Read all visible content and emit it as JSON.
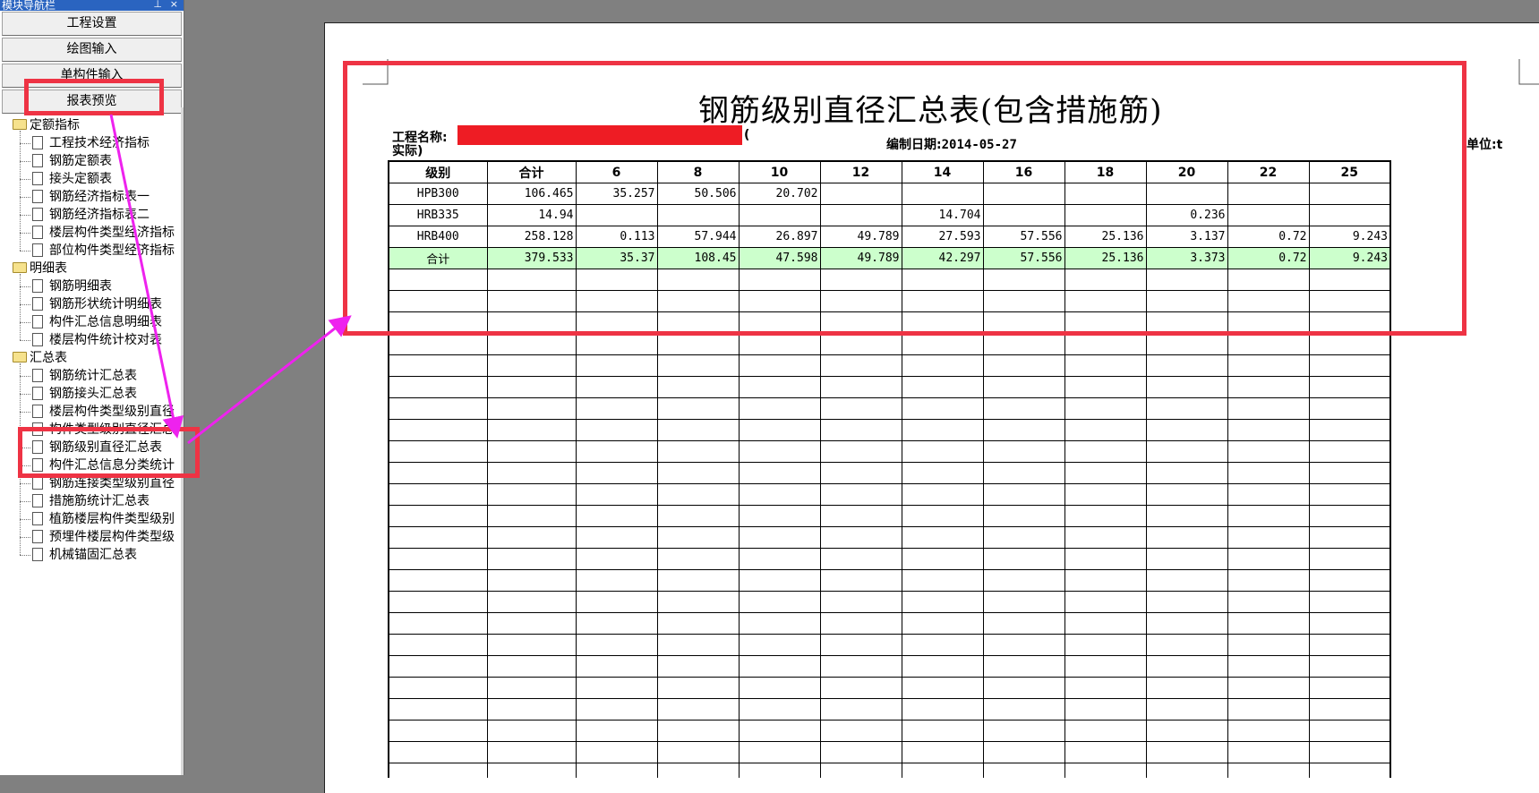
{
  "nav": {
    "title": "模块导航栏",
    "pin_glyph": "⊥",
    "close_glyph": "×",
    "buttons": [
      "工程设置",
      "绘图输入",
      "单构件输入",
      "报表预览"
    ],
    "groups": [
      {
        "label": "定额指标",
        "items": [
          "工程技术经济指标",
          "钢筋定额表",
          "接头定额表",
          "钢筋经济指标表一",
          "钢筋经济指标表二",
          "楼层构件类型经济指标",
          "部位构件类型经济指标"
        ]
      },
      {
        "label": "明细表",
        "items": [
          "钢筋明细表",
          "钢筋形状统计明细表",
          "构件汇总信息明细表",
          "楼层构件统计校对表"
        ]
      },
      {
        "label": "汇总表",
        "items": [
          "钢筋统计汇总表",
          "钢筋接头汇总表",
          "楼层构件类型级别直径",
          "构件类型级别直径汇总",
          "钢筋级别直径汇总表",
          "构件汇总信息分类统计",
          "钢筋连接类型级别直径",
          "措施筋统计汇总表",
          "植筋楼层构件类型级别",
          "预埋件楼层构件类型级",
          "机械锚固汇总表"
        ]
      }
    ]
  },
  "report": {
    "title": "钢筋级别直径汇总表(包含措施筋)",
    "project_label": "工程名称:",
    "project_suffix": "(",
    "project_line2": "实际)",
    "date_label": "编制日期:",
    "date_value": "2014-05-27",
    "unit_label": "单位:",
    "unit_value": "t",
    "columns": [
      "级别",
      "合计",
      "6",
      "8",
      "10",
      "12",
      "14",
      "16",
      "18",
      "20",
      "22",
      "25"
    ],
    "rows": [
      {
        "grade": "HPB300",
        "cells": [
          "106.465",
          "35.257",
          "50.506",
          "20.702",
          "",
          "",
          "",
          "",
          "",
          "",
          ""
        ]
      },
      {
        "grade": "HRB335",
        "cells": [
          "14.94",
          "",
          "",
          "",
          "",
          "14.704",
          "",
          "",
          "0.236",
          "",
          ""
        ]
      },
      {
        "grade": "HRB400",
        "cells": [
          "258.128",
          "0.113",
          "57.944",
          "26.897",
          "49.789",
          "27.593",
          "57.556",
          "25.136",
          "3.137",
          "0.72",
          "9.243"
        ]
      }
    ],
    "total": {
      "grade": "合计",
      "cells": [
        "379.533",
        "35.37",
        "108.45",
        "47.598",
        "49.789",
        "42.297",
        "57.556",
        "25.136",
        "3.373",
        "0.72",
        "9.243"
      ]
    },
    "empty_rows": 24
  },
  "colors": {
    "highlight": "#ee3344",
    "arrow": "#ee22ee",
    "total_row": "#ccffcc",
    "nav_title": "#2a64c0",
    "redaction": "#ee1c24"
  }
}
